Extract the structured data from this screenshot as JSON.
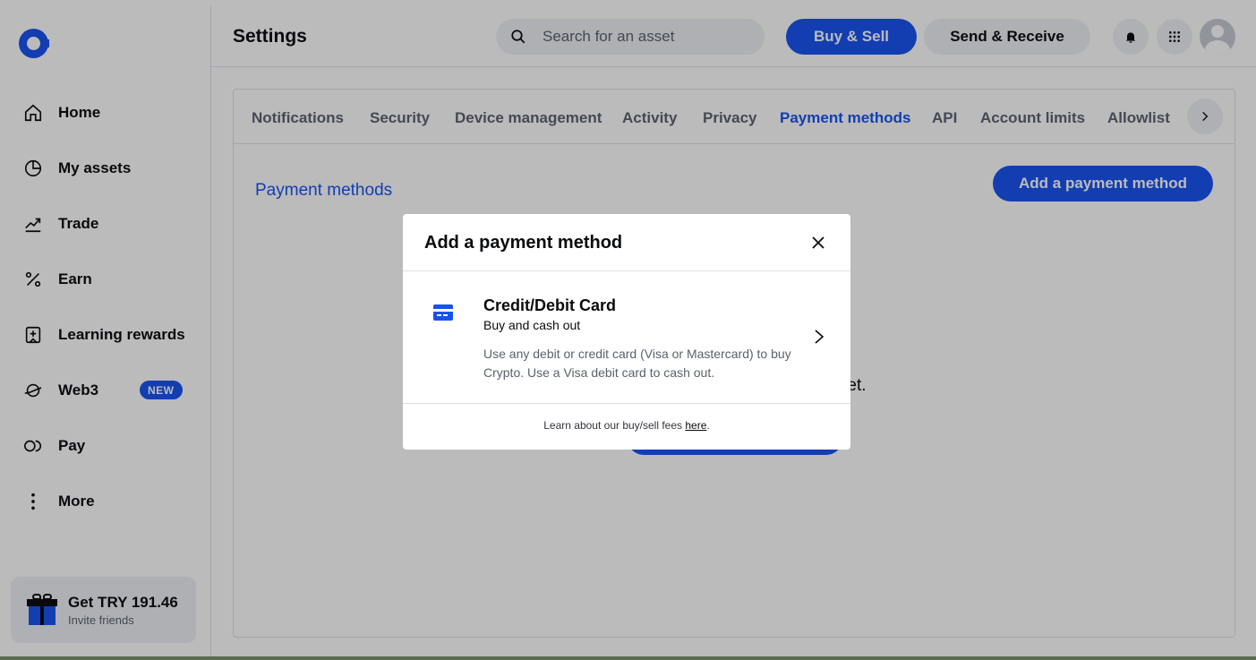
{
  "sidebar": {
    "items": [
      {
        "label": "Home",
        "icon": "home-icon"
      },
      {
        "label": "My assets",
        "icon": "pie-chart-icon"
      },
      {
        "label": "Trade",
        "icon": "trend-chart-icon"
      },
      {
        "label": "Earn",
        "icon": "percent-icon"
      },
      {
        "label": "Learning rewards",
        "icon": "reward-icon"
      },
      {
        "label": "Web3",
        "icon": "planet-icon",
        "badge": "NEW"
      },
      {
        "label": "Pay",
        "icon": "pay-icon"
      },
      {
        "label": "More",
        "icon": "more-vertical-icon"
      }
    ],
    "promo": {
      "title": "Get TRY 191.46",
      "subtitle": "Invite friends"
    }
  },
  "header": {
    "title": "Settings",
    "search_placeholder": "Search for an asset",
    "buy_sell_label": "Buy & Sell",
    "send_receive_label": "Send & Receive"
  },
  "tabs": [
    {
      "label": "Notifications"
    },
    {
      "label": "Security"
    },
    {
      "label": "Device management"
    },
    {
      "label": "Activity"
    },
    {
      "label": "Privacy"
    },
    {
      "label": "Payment methods",
      "active": true
    },
    {
      "label": "API"
    },
    {
      "label": "Account limits"
    },
    {
      "label": "Allowlist"
    }
  ],
  "main": {
    "section_title": "Payment methods",
    "add_button_label": "Add a payment method",
    "empty_text": "ods yet."
  },
  "modal": {
    "title": "Add a payment method",
    "option": {
      "title": "Credit/Debit Card",
      "subtitle": "Buy and cash out",
      "description": "Use any debit or credit card (Visa or Mastercard) to buy Crypto. Use a Visa debit card to cash out."
    },
    "footer_text": "Learn about our buy/sell fees ",
    "footer_link": "here",
    "footer_end": "."
  },
  "colors": {
    "accent": "#1652f0",
    "text": "#0a0b0d",
    "muted": "#5b616e"
  }
}
